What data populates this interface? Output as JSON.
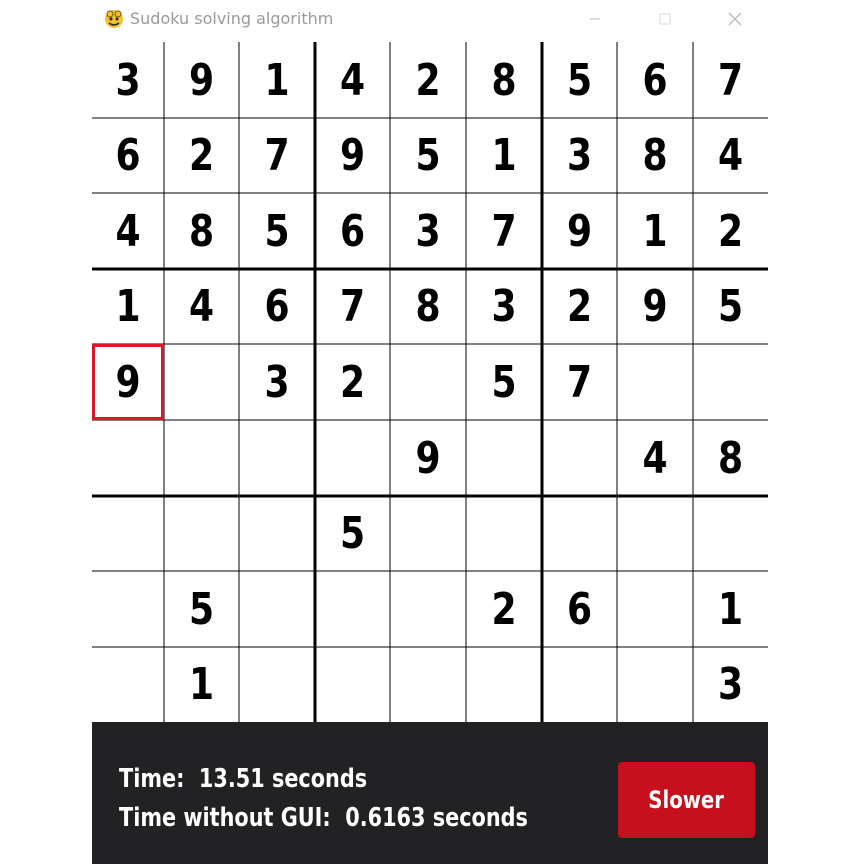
{
  "window": {
    "title": "Sudoku solving algorithm",
    "app_icon": "pygame-snake-icon",
    "controls": [
      "minimize-icon",
      "maximize-icon",
      "close-icon"
    ]
  },
  "board": {
    "rows": [
      [
        "3",
        "9",
        "1",
        "4",
        "2",
        "8",
        "5",
        "6",
        "7"
      ],
      [
        "6",
        "2",
        "7",
        "9",
        "5",
        "1",
        "3",
        "8",
        "4"
      ],
      [
        "4",
        "8",
        "5",
        "6",
        "3",
        "7",
        "9",
        "1",
        "2"
      ],
      [
        "1",
        "4",
        "6",
        "7",
        "8",
        "3",
        "2",
        "9",
        "5"
      ],
      [
        "9",
        "",
        "3",
        "2",
        "",
        "5",
        "7",
        "",
        ""
      ],
      [
        "",
        "",
        "",
        "",
        "9",
        "",
        "",
        "4",
        "8"
      ],
      [
        "",
        "",
        "",
        "5",
        "",
        "",
        "",
        "",
        ""
      ],
      [
        "",
        "5",
        "",
        "",
        "",
        "2",
        "6",
        "",
        "1"
      ],
      [
        "",
        "1",
        "",
        "",
        "",
        "",
        "",
        "",
        "3"
      ]
    ],
    "selected_cell": {
      "row": 4,
      "col": 0
    },
    "selection_color": "#d9192a"
  },
  "footer": {
    "time_label": "Time:",
    "time_value": "13.51 seconds",
    "gui_label": "Time without GUI:",
    "gui_value": "0.6163 seconds",
    "slower_button_label": "Slower",
    "button_color": "#c7101d",
    "background_color": "#222225"
  }
}
